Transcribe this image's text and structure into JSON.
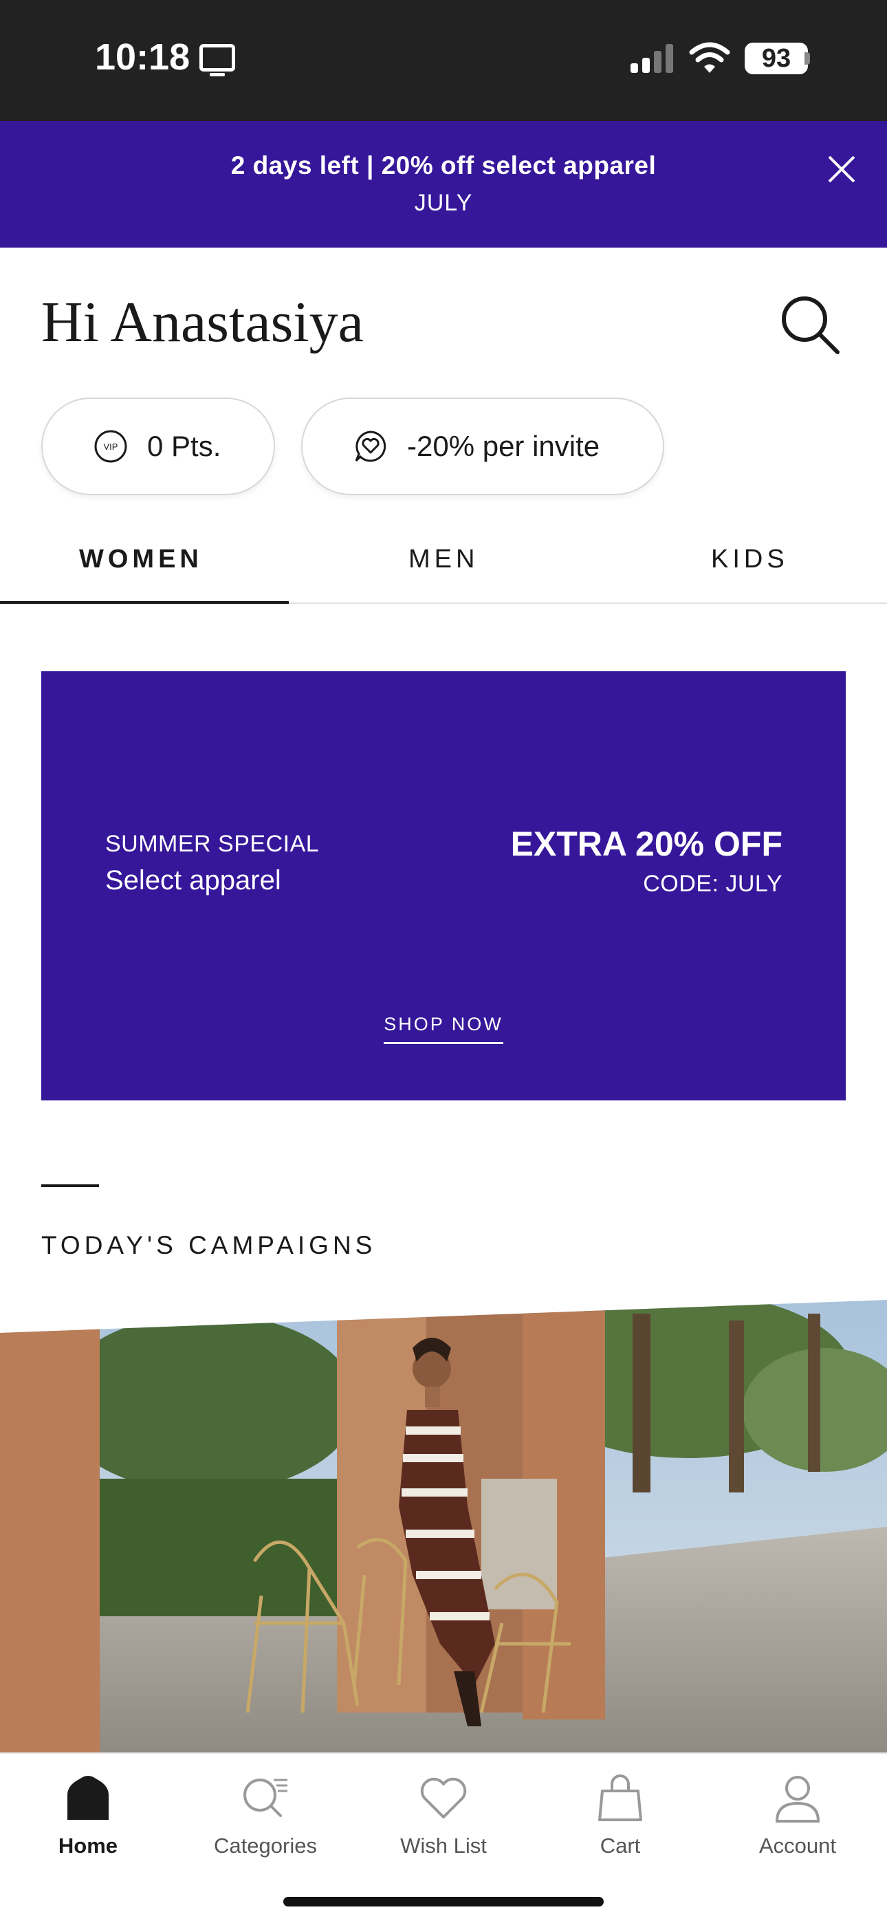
{
  "status_bar": {
    "time": "10:18",
    "battery": "93"
  },
  "promo_banner": {
    "title": "2 days left | 20% off select apparel",
    "code": "JULY"
  },
  "header": {
    "greeting": "Hi Anastasiya"
  },
  "pills": {
    "vip_badge": "VIP",
    "points": "0 Pts.",
    "invite": "-20% per invite"
  },
  "tabs": [
    {
      "label": "WOMEN",
      "active": true
    },
    {
      "label": "MEN",
      "active": false
    },
    {
      "label": "KIDS",
      "active": false
    }
  ],
  "hero": {
    "kicker": "SUMMER SPECIAL",
    "subtitle": "Select apparel",
    "offer": "EXTRA 20% OFF",
    "offer_code": "CODE: JULY",
    "cta": "SHOP NOW",
    "background": "#36179a"
  },
  "campaigns": {
    "title": "TODAY'S CAMPAIGNS"
  },
  "bottom_nav": [
    {
      "label": "Home",
      "icon": "home-icon",
      "active": true
    },
    {
      "label": "Categories",
      "icon": "categories-search-icon",
      "active": false
    },
    {
      "label": "Wish List",
      "icon": "heart-icon",
      "active": false
    },
    {
      "label": "Cart",
      "icon": "shopping-bag-icon",
      "active": false
    },
    {
      "label": "Account",
      "icon": "person-icon",
      "active": false
    }
  ],
  "colors": {
    "brand_purple": "#36179a",
    "status_bar": "#222222"
  }
}
